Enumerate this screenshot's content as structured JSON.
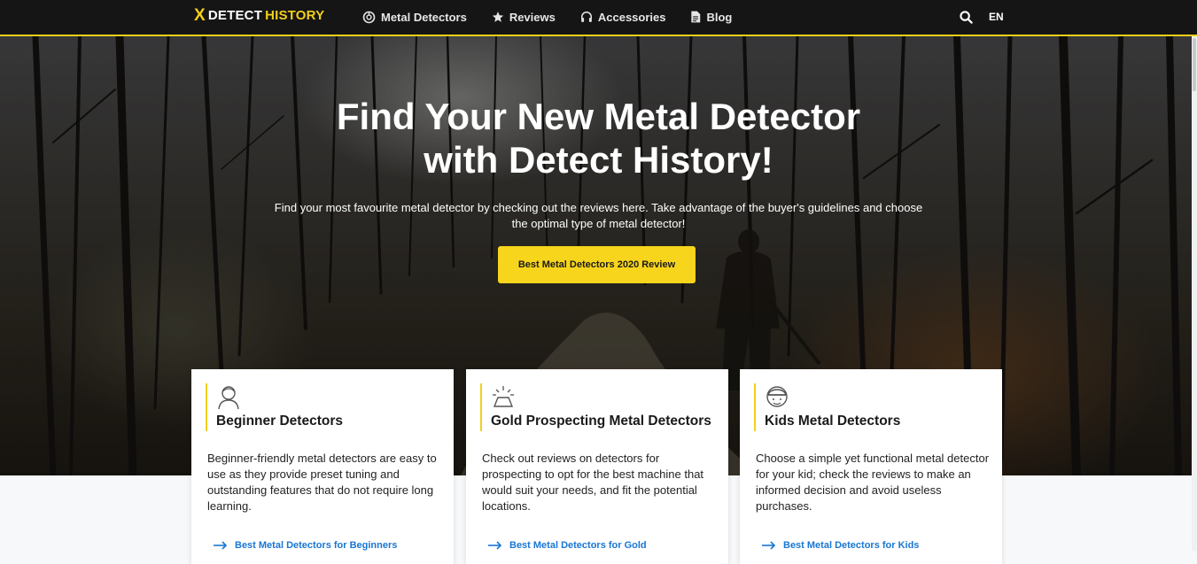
{
  "logo": {
    "mark": "X",
    "brand_a": "DETECT",
    "brand_b": "HISTORY"
  },
  "nav": {
    "items": [
      {
        "label": "Metal Detectors",
        "icon": "detector-icon"
      },
      {
        "label": "Reviews",
        "icon": "star-icon"
      },
      {
        "label": "Accessories",
        "icon": "headphones-icon"
      },
      {
        "label": "Blog",
        "icon": "document-icon"
      }
    ],
    "search_icon": "search-icon",
    "language": "EN"
  },
  "hero": {
    "title_line1": "Find Your New Metal Detector",
    "title_line2": "with Detect History!",
    "subtitle": "Find your most favourite metal detector by checking out the reviews here. Take advantage of the buyer's guidelines and choose the optimal type of metal detector!",
    "cta_label": "Best Metal Detectors 2020 Review"
  },
  "cards": [
    {
      "title": "Beginner Detectors",
      "icon": "person-icon",
      "text": "Beginner-friendly metal detectors are easy to use as they provide preset tuning and outstanding features that do not require long learning.",
      "link": "Best Metal Detectors for Beginners"
    },
    {
      "title": "Gold Prospecting Metal Detectors",
      "icon": "gold-bar-icon",
      "text": "Check out reviews on detectors for prospecting to opt for the best machine that would suit your needs, and fit the potential locations.",
      "link": "Best Metal Detectors for Gold"
    },
    {
      "title": "Kids Metal Detectors",
      "icon": "kid-helmet-icon",
      "text": "Choose a simple yet functional metal detector for your kid; check the reviews to make an informed decision and avoid useless purchases.",
      "link": "Best Metal Detectors for Kids"
    }
  ],
  "colors": {
    "accent": "#f2cf1b",
    "nav_bg": "#151515",
    "link": "#1976d2",
    "cta_bg": "#f7d51d"
  }
}
